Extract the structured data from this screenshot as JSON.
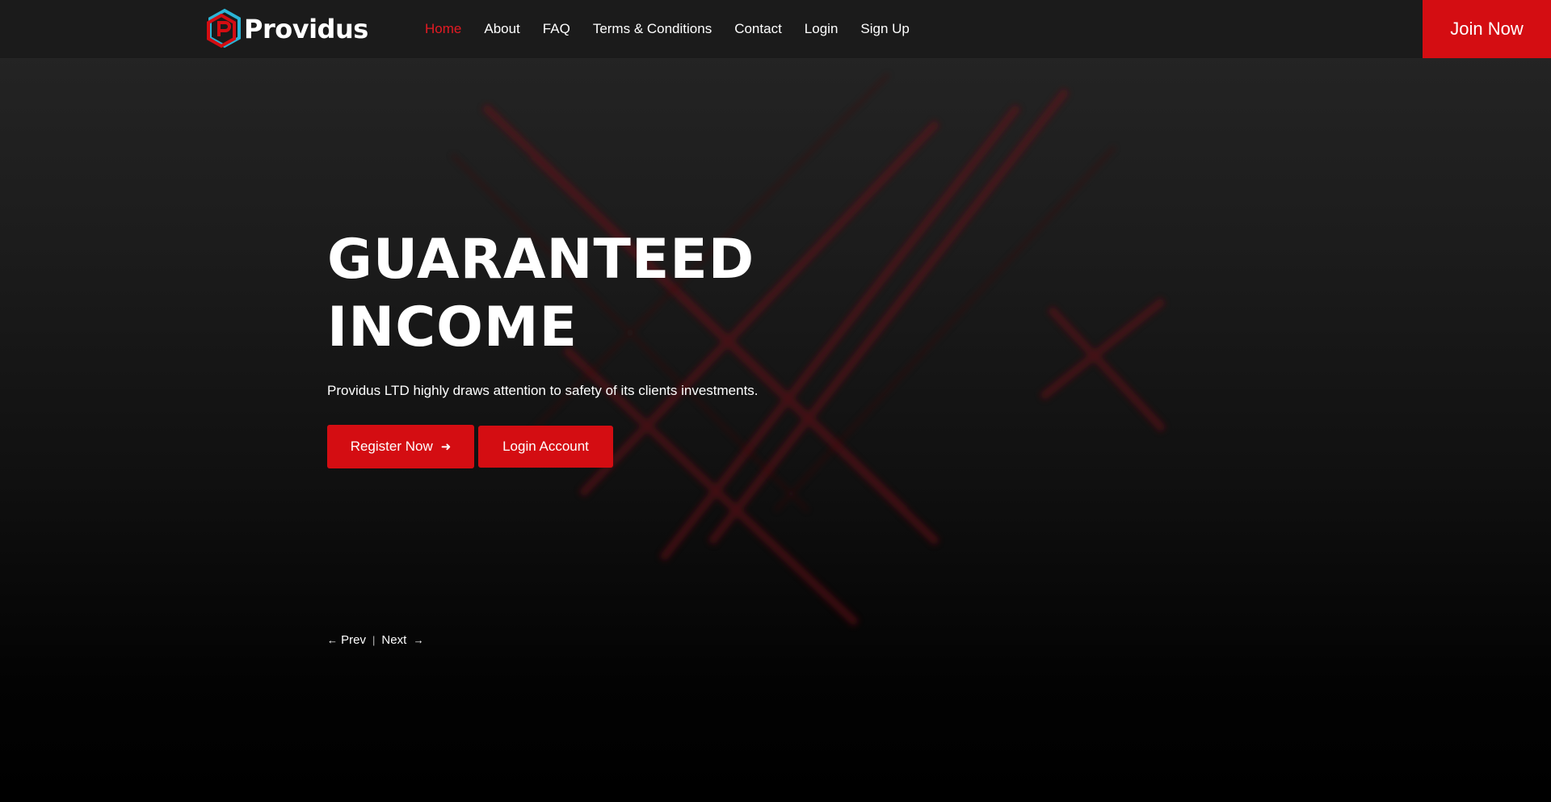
{
  "brand": {
    "name": "Providus",
    "logo_icon": "hexagon-p-logo-icon",
    "accent_color": "#d40d12",
    "secondary_color": "#2bb5d6"
  },
  "nav": {
    "items": [
      {
        "label": "Home",
        "active": true
      },
      {
        "label": "About"
      },
      {
        "label": "FAQ"
      },
      {
        "label": "Terms & Conditions"
      },
      {
        "label": "Contact"
      },
      {
        "label": "Login"
      },
      {
        "label": "Sign Up"
      }
    ],
    "join_label": "Join Now"
  },
  "hero": {
    "title_line1": "GUARANTEED",
    "title_line2": "INCOME",
    "subtitle": "Providus LTD highly draws attention to safety of its clients investments.",
    "register_label": "Register Now",
    "login_label": "Login Account"
  },
  "slider": {
    "prev_label": "Prev",
    "separator": "|",
    "next_label": "Next"
  }
}
